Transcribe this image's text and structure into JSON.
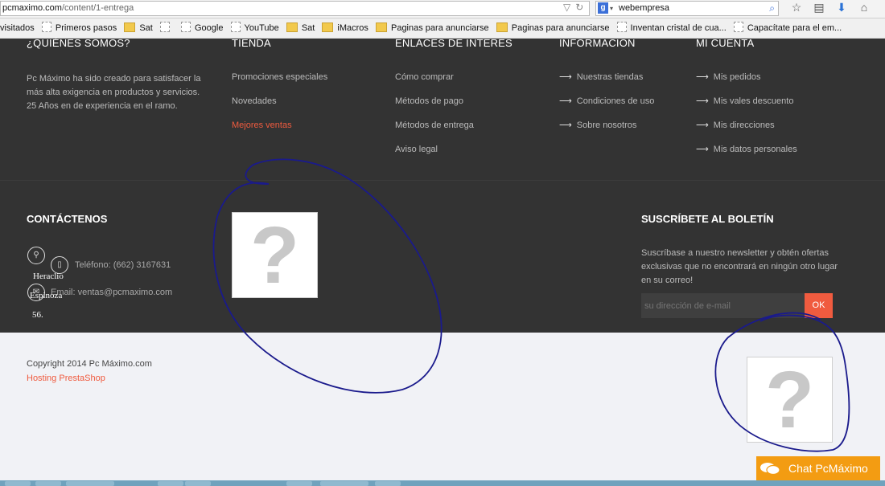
{
  "browser": {
    "url_host": "pcmaximo.com",
    "url_path": "/content/1-entrega",
    "search_value": "webempresa",
    "bookmarks": [
      "visitados",
      "Primeros pasos",
      "Sat",
      "",
      "Google",
      "YouTube",
      "Sat",
      "iMacros",
      "Paginas para anunciarse",
      "Paginas para anunciarse",
      "Inventan cristal de cua...",
      "Capacítate para el em..."
    ]
  },
  "footer": {
    "about": {
      "title": "¿QUIÉNES SOMOS?",
      "text": "Pc Máximo ha sido creado para satisfacer la más alta exigencia en productos y servicios.\n25 Años en de experiencia en el ramo."
    },
    "tienda": {
      "title": "TIENDA",
      "items": [
        "Promociones especiales",
        "Novedades",
        "Mejores ventas"
      ]
    },
    "enlaces": {
      "title": "ENLACES DE INTERES",
      "items": [
        "Cómo comprar",
        "Métodos de pago",
        "Métodos de entrega",
        "Aviso legal"
      ]
    },
    "informacion": {
      "title": "INFORMACION",
      "items": [
        "Nuestras tiendas",
        "Condiciones de uso",
        "Sobre nosotros"
      ]
    },
    "cuenta": {
      "title": "MI CUENTA",
      "items": [
        "Mis pedidos",
        "Mis vales descuento",
        "Mis direcciones",
        "Mis datos personales"
      ]
    },
    "contact": {
      "title": "CONTÁCTENOS",
      "address_lines": [
        "Heraclio",
        "Espinoza",
        "56."
      ],
      "phone": "Teléfono: (662) 3167631",
      "email": "Email: ventas@pcmaximo.com"
    },
    "newsletter": {
      "title": "SUSCRÍBETE AL BOLETÍN",
      "text": "Suscríbase a nuestro newsletter y obtén ofertas exclusivas que no encontrará en ningún otro lugar en su correo!",
      "placeholder": "su dirección de e-mail",
      "button": "OK"
    },
    "copyright": "Copyright 2014 Pc Máximo.com",
    "hosting": "Hosting PrestaShop"
  },
  "placeholder_glyph": "?",
  "chat": {
    "label": "Chat PcMáximo"
  },
  "colors": {
    "accent": "#f05b3f",
    "footer_bg": "#333333",
    "chat_bg": "#f39c12",
    "annotation": "#1a1a8c"
  }
}
